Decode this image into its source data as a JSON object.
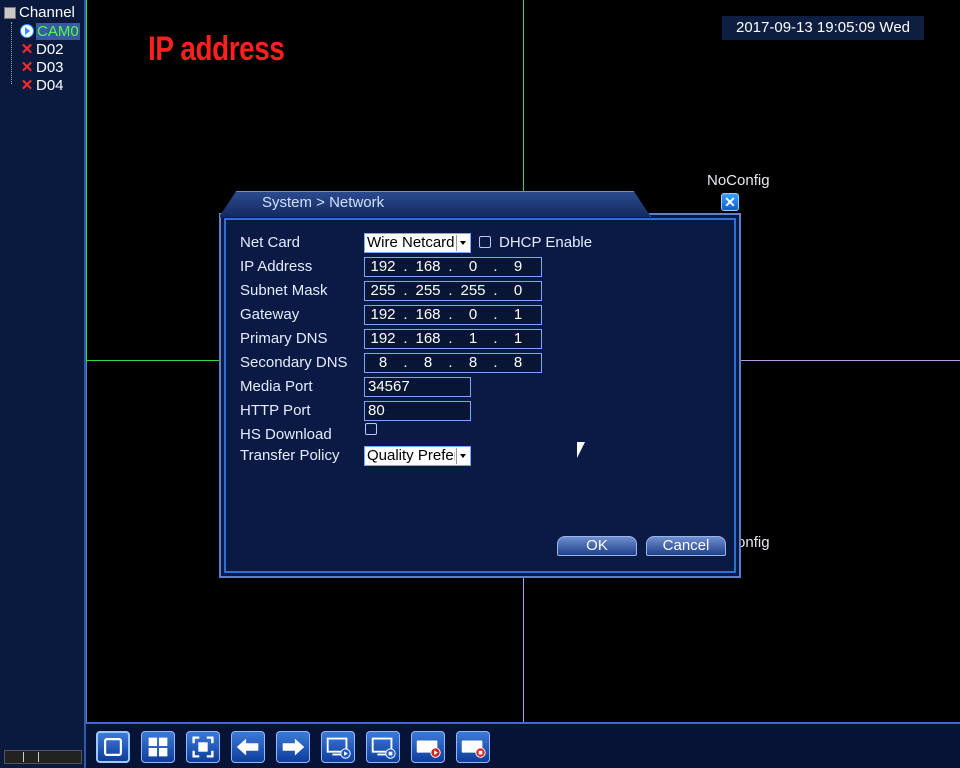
{
  "channel_panel": {
    "title": "Channel",
    "items": [
      {
        "label": "CAM0",
        "icon": "play-icon",
        "active": true
      },
      {
        "label": "D02",
        "icon": "x-icon"
      },
      {
        "label": "D03",
        "icon": "x-icon"
      },
      {
        "label": "D04",
        "icon": "x-icon"
      }
    ]
  },
  "overlay": {
    "annotation": "IP address",
    "datetime": "2017-09-13 19:05:09 Wed",
    "noconfig_1": "NoConfig",
    "noconfig_2": "NoConfig"
  },
  "dialog": {
    "title": "System > Network",
    "fields": {
      "net_card_label": "Net Card",
      "net_card_value": "Wire Netcard",
      "dhcp_label": "DHCP Enable",
      "ip_label": "IP Address",
      "ip": [
        "192",
        "168",
        "0",
        "9"
      ],
      "subnet_label": "Subnet Mask",
      "subnet": [
        "255",
        "255",
        "255",
        "0"
      ],
      "gateway_label": "Gateway",
      "gateway": [
        "192",
        "168",
        "0",
        "1"
      ],
      "pdns_label": "Primary DNS",
      "pdns": [
        "192",
        "168",
        "1",
        "1"
      ],
      "sdns_label": "Secondary DNS",
      "sdns": [
        "8",
        "8",
        "8",
        "8"
      ],
      "media_port_label": "Media Port",
      "media_port": "34567",
      "http_port_label": "HTTP Port",
      "http_port": "80",
      "hs_download_label": "HS Download",
      "transfer_policy_label": "Transfer Policy",
      "transfer_policy_value": "Quality Prefer"
    },
    "ok_label": "OK",
    "cancel_label": "Cancel"
  },
  "toolbar": {
    "buttons": [
      "single-view-icon",
      "quad-view-icon",
      "fullscreen-icon",
      "previous-icon",
      "next-icon",
      "playback-icon",
      "record-icon",
      "record-play-icon",
      "record-stop-icon"
    ]
  },
  "colors": {
    "grid_green": "#2fd94a",
    "grid_violet": "#b99ae0",
    "annotation_red": "#ff1f1f",
    "panel_blue": "#0a1a44"
  }
}
